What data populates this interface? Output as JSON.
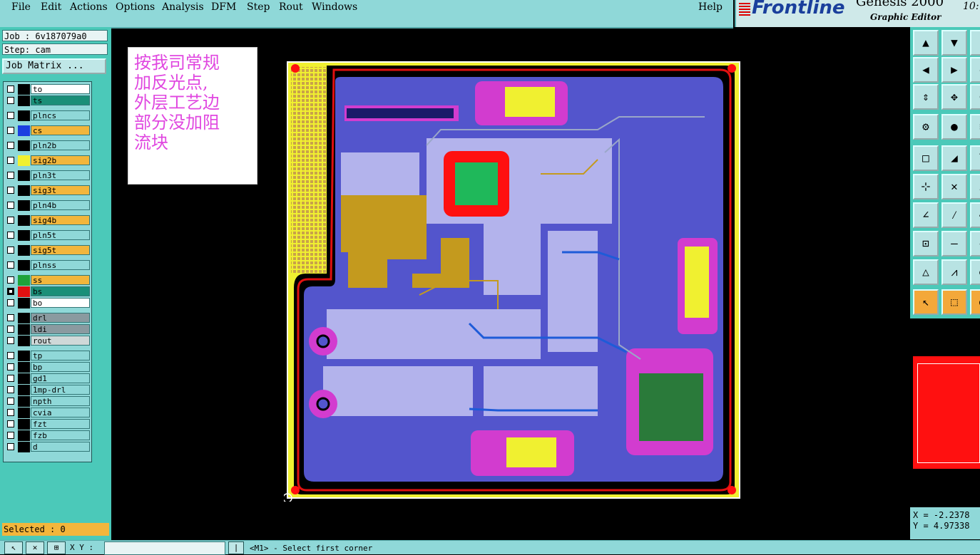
{
  "menu": [
    "File",
    "Edit",
    "Actions",
    "Options",
    "Analysis",
    "DFM",
    "Step",
    "Rout",
    "Windows"
  ],
  "help": "Help",
  "logo": {
    "brand": "Frontline",
    "product": "Genesis 2000",
    "subtitle": "Graphic Editor",
    "time": "10:"
  },
  "job": {
    "label": "Job : 6v187079a0",
    "step": "Step: cam",
    "matrix_button": "Job Matrix ..."
  },
  "layers": [
    {
      "name": "to",
      "swatch": "#000000",
      "bg": "#ffffff"
    },
    {
      "name": "ts",
      "swatch": "#000000",
      "bg": "#1a8f78"
    },
    {
      "name": "plncs",
      "swatch": "#000000",
      "bg": "#8fd8d8"
    },
    {
      "name": "cs",
      "swatch": "#1b3fe0",
      "bg": "#f2b63c"
    },
    {
      "name": "pln2b",
      "swatch": "#000000",
      "bg": "#8fd8d8"
    },
    {
      "name": "sig2b",
      "swatch": "#f0f030",
      "bg": "#f2b63c"
    },
    {
      "name": "pln3t",
      "swatch": "#000000",
      "bg": "#8fd8d8"
    },
    {
      "name": "sig3t",
      "swatch": "#000000",
      "bg": "#f2b63c"
    },
    {
      "name": "pln4b",
      "swatch": "#000000",
      "bg": "#8fd8d8"
    },
    {
      "name": "sig4b",
      "swatch": "#000000",
      "bg": "#f2b63c"
    },
    {
      "name": "pln5t",
      "swatch": "#000000",
      "bg": "#8fd8d8"
    },
    {
      "name": "sig5t",
      "swatch": "#000000",
      "bg": "#f2b63c"
    },
    {
      "name": "plnss",
      "swatch": "#000000",
      "bg": "#8fd8d8"
    },
    {
      "name": "ss",
      "swatch": "#1fa23a",
      "bg": "#f2b63c"
    },
    {
      "name": "bs",
      "swatch": "#e01010",
      "bg": "#1a8f78",
      "selected": true
    },
    {
      "name": "bo",
      "swatch": "#000000",
      "bg": "#ffffff"
    },
    {
      "name": "drl",
      "swatch": "#000000",
      "bg": "#8a9aa0"
    },
    {
      "name": "ldi",
      "swatch": "#000000",
      "bg": "#8a9aa0"
    },
    {
      "name": "rout",
      "swatch": "#000000",
      "bg": "#cfd8d8"
    },
    {
      "name": "tp",
      "swatch": "#000000",
      "bg": "#8fd8d8"
    },
    {
      "name": "bp",
      "swatch": "#000000",
      "bg": "#8fd8d8"
    },
    {
      "name": "gd1",
      "swatch": "#000000",
      "bg": "#8fd8d8"
    },
    {
      "name": "1mp-drl",
      "swatch": "#000000",
      "bg": "#8fd8d8"
    },
    {
      "name": "npth",
      "swatch": "#000000",
      "bg": "#8fd8d8"
    },
    {
      "name": "cvia",
      "swatch": "#000000",
      "bg": "#8fd8d8"
    },
    {
      "name": "fzt",
      "swatch": "#000000",
      "bg": "#8fd8d8"
    },
    {
      "name": "fzb",
      "swatch": "#000000",
      "bg": "#8fd8d8"
    },
    {
      "name": "d",
      "swatch": "#000000",
      "bg": "#8fd8d8"
    }
  ],
  "selected_text": "Selected : 0",
  "note": [
    "按我司常规",
    "加反光点,",
    "外层工艺边",
    "部分没加阻",
    "流块"
  ],
  "coords": {
    "x": "X = -2.2378",
    "y": "Y = 4.97338"
  },
  "bottom": {
    "xy_label": "X Y :",
    "prompt": "<M1> - Select first corner"
  },
  "colors": {
    "menubar": "#8fd8d8",
    "panel": "#4bc9b9",
    "board_border": "#f0f030",
    "plane": "#5355cc",
    "copper": "#c49a1e",
    "solder": "#d23ccf",
    "pad_red": "#ff1010"
  }
}
